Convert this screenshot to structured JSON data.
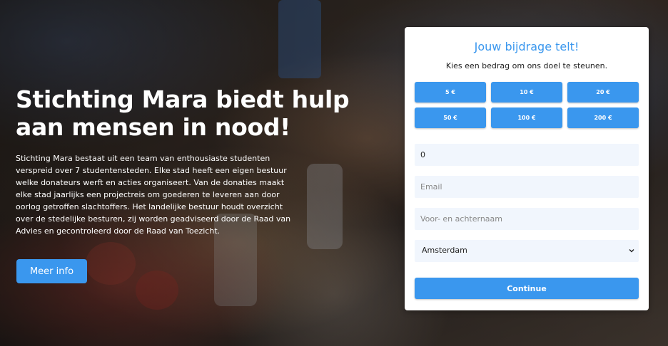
{
  "hero": {
    "headline": "Stichting Mara biedt hulp aan mensen in nood!",
    "description": "Stichting Mara bestaat uit een team van enthousiaste studenten verspreid over 7 studentensteden. Elke stad heeft een eigen bestuur welke donateurs werft en acties organiseert. Van de donaties maakt elke stad jaarlijks een projectreis om goederen te leveren aan door oorlog getroffen slachtoffers. Het landelijke bestuur houdt overzicht over de stedelijke besturen, zij worden geadviseerd door de Raad van Advies en gecontroleerd door de Raad van Toezicht.",
    "more_info_label": "Meer info"
  },
  "donation_form": {
    "title": "Jouw bijdrage telt!",
    "subtitle": "Kies een bedrag om ons doel te steunen.",
    "amounts": [
      "5 €",
      "10 €",
      "20 €",
      "50 €",
      "100 €",
      "200 €"
    ],
    "amount_value": "0",
    "email_placeholder": "Email",
    "name_placeholder": "Voor- en achternaam",
    "city_selected": "Amsterdam",
    "continue_label": "Continue"
  },
  "colors": {
    "accent": "#3a97ee",
    "field_background": "#f1f6fd"
  },
  "icons": {
    "select_arrow": "chevron-down-icon"
  }
}
